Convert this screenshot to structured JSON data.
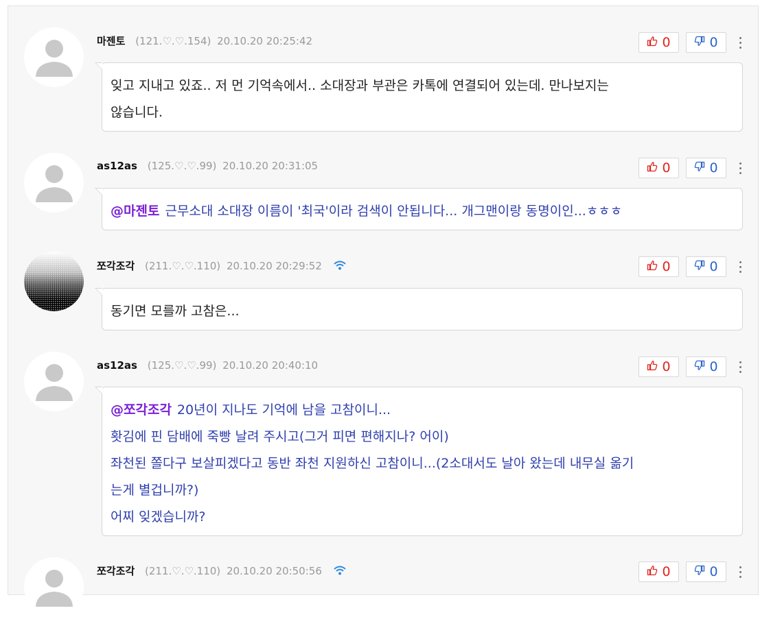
{
  "comments": [
    {
      "author": "마젠토",
      "ip": "(121.♡.♡.154)",
      "datetime": "20.10.20 20:25:42",
      "avatar": "default-avatar",
      "likes": "0",
      "dislikes": "0",
      "mention": "",
      "lines": [
        "잊고 지내고 있죠..  저 먼 기억속에서..  소대장과 부관은 카톡에 연결되어 있는데.  만나보지는",
        "않습니다."
      ]
    },
    {
      "author": "as12as",
      "ip": "(125.♡.♡.99)",
      "datetime": "20.10.20 20:31:05",
      "avatar": "default-avatar",
      "likes": "0",
      "dislikes": "0",
      "mention": "@마젠토",
      "lines": [
        "근무소대 소대장 이름이 '최국'이라 검색이 안됩니다... 개그맨이랑 동명이인...ㅎㅎㅎ"
      ]
    },
    {
      "author": "쪼각조각",
      "ip": "(211.♡.♡.110)",
      "datetime": "20.10.20 20:29:52",
      "avatar": "dither-avatar",
      "wifi_icon": "wifi-icon",
      "likes": "0",
      "dislikes": "0",
      "mention": "",
      "lines": [
        "동기면 모를까 고참은..."
      ]
    },
    {
      "author": "as12as",
      "ip": "(125.♡.♡.99)",
      "datetime": "20.10.20 20:40:10",
      "avatar": "default-avatar",
      "likes": "0",
      "dislikes": "0",
      "mention": "@쪼각조각",
      "lines": [
        "20년이 지나도 기억에 남을 고참이니...",
        "홧김에 핀 담배에 죽빵 날려 주시고(그거 피면 편해지나? 어이)",
        "좌천된 쫄다구 보살피겠다고 동반 좌천 지원하신 고참이니...(2소대서도 날아 왔는데 내무실 옮기",
        "는게 별겁니까?)",
        "어찌 잊겠습니까?"
      ]
    },
    {
      "author": "쪼각조각",
      "ip": "(211.♡.♡.110)",
      "datetime": "20.10.20 20:50:56",
      "avatar": "default-avatar",
      "wifi_icon": "wifi-icon",
      "likes": "0",
      "dislikes": "0",
      "mention": "",
      "lines": []
    }
  ],
  "icons": {
    "like": "thumbs-up-icon",
    "dislike": "thumbs-down-icon",
    "more": "more-vertical-icon"
  },
  "colors": {
    "like": "#e0231b",
    "dislike": "#2a64c8",
    "mention": "#7b1fd6",
    "reply_text": "#2f3fae",
    "wifi": "#2a8ae0"
  }
}
